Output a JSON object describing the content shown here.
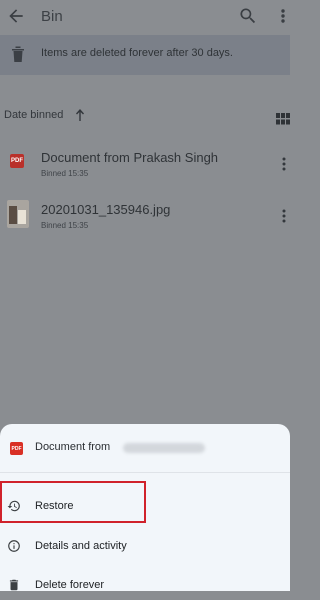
{
  "app_bar": {
    "title": "Bin",
    "back_icon": "arrow-back-icon",
    "search_icon": "search-icon",
    "more_icon": "more-vert-icon"
  },
  "notice": {
    "text": "Items are deleted forever after 30 days.",
    "icon": "trash-icon"
  },
  "sort": {
    "label": "Date binned",
    "direction_icon": "arrow-up-icon",
    "view_icon": "grid-view-icon"
  },
  "files": [
    {
      "name": "Document from Prakash Singh",
      "subtitle": "Binned 15:35",
      "type": "PDF",
      "icon": "pdf-icon"
    },
    {
      "name": "20201031_135946.jpg",
      "subtitle": "Binned 15:35",
      "type": "image",
      "icon": "image-thumbnail"
    }
  ],
  "sheet": {
    "file_label": "Document from",
    "file_badge": "PDF",
    "menu": [
      {
        "label": "Restore",
        "icon": "restore-icon"
      },
      {
        "label": "Details and activity",
        "icon": "info-icon"
      },
      {
        "label": "Delete forever",
        "icon": "delete-icon"
      }
    ]
  },
  "colors": {
    "scrim": "#8a8d91",
    "sheet_bg": "#f2f6fa",
    "highlight": "#d0222b",
    "pdf_red": "#d93025"
  }
}
